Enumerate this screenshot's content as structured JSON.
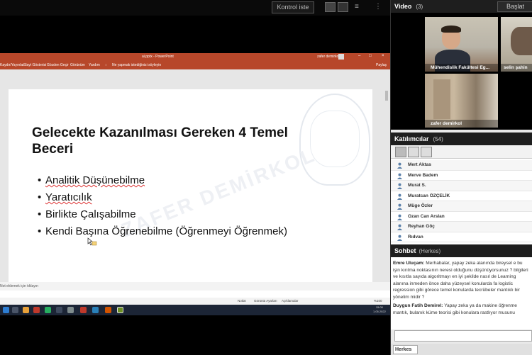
{
  "toolbar": {
    "kontrol_label": "Kontrol iste"
  },
  "ppt": {
    "doc_title": "ai.pptx - PowerPoint",
    "user": "zafer demirkol",
    "menu": [
      "Kaydır/Yayınlar",
      "Slayt Gösterisi",
      "Gözden Geçir",
      "Görünüm",
      "Yardım",
      "Ne yapmak istediğinizi söyleyin",
      "Paylaş"
    ],
    "slide_title": "Gelecekte Kazanılması Gereken 4 Temel Beceri",
    "bullets": [
      "Analitik Düşünebilme",
      "Yaratıcılık",
      "Birlikte Çalışabilme",
      "Kendi Başına Öğrenebilme (Öğrenmeyi Öğrenmek)"
    ],
    "watermark": "ZAFER DEMİRKOL",
    "notes": "Not eklemek için tıklayın",
    "status": [
      "Notlar",
      "Görüntü Ayarları",
      "Açıklamalar"
    ],
    "zoom": "%100",
    "clock_time": "15:00",
    "clock_date": "1.05.2022"
  },
  "video": {
    "title": "Video",
    "count": "(3)",
    "start_label": "Başlat",
    "tiles": [
      "Mühendislik Fakültesi Eg...",
      "selin şahin",
      "zafer demirkol"
    ]
  },
  "participants": {
    "title": "Katılımcılar",
    "count": "(54)",
    "list": [
      "Mert Aktas",
      "Merve Badem",
      "Murat S.",
      "Muratcan ÖZÇELİK",
      "Müge Özler",
      "Ozan Can Arslan",
      "Reyhan Göç",
      "Rıdvan"
    ]
  },
  "chat": {
    "title": "Sohbet",
    "scope": "(Herkes)",
    "messages": [
      {
        "author": "Emre Uluçam:",
        "text": "Merhabalar, yapay zeka alanında bireysel e bu işin kırılma noktasının neresi olduğunu düşünüyorsunuz ? bilgileri ve kısıtla sayıda algoritmayı en iyi şekilde nasıl de Learning alanına inmeden önce daha yüzeysel konularda fa logistic regression gibi görece temel konularda tecrübeler mantıklı bir yönelim midir ?"
      },
      {
        "author": "Duygun Fatih Demirel:",
        "text": "Yapay zeka ya da makine öğrenme mantık, bulanık küme teorisi gibi konulara rastlıyor musunu"
      }
    ],
    "target": "Herkes"
  }
}
